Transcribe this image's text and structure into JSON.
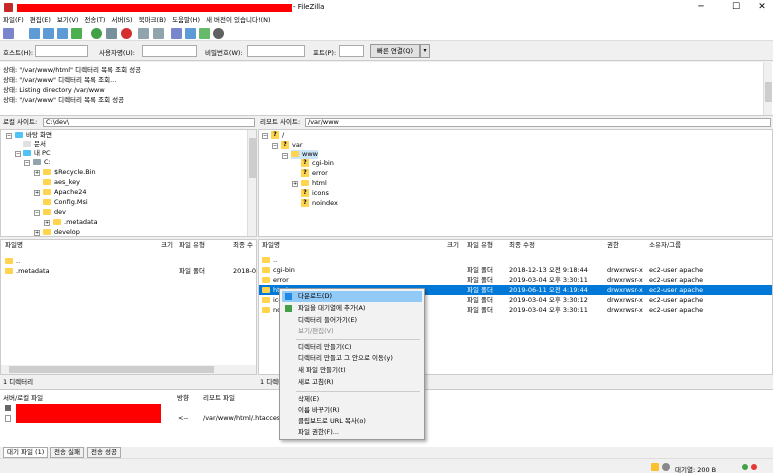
{
  "window": {
    "title": "- FileZilla",
    "minimize": "─",
    "maximize": "☐",
    "close": "✕"
  },
  "menu": [
    "파일(F)",
    "편집(E)",
    "보기(V)",
    "전송(T)",
    "서버(S)",
    "북마크(B)",
    "도움말(H)",
    "새 버전이 있습니다!(N)"
  ],
  "quickconnect": {
    "host_label": "호스트(H):",
    "user_label": "사용자명(U):",
    "pass_label": "비밀번호(W):",
    "port_label": "포트(P):",
    "button": "빠른 연결(Q)",
    "dropdown": "▾"
  },
  "log": [
    "상태:   \"/var/www/html\" 디렉터리 목록 조회 성공",
    "상태:   \"/var/www\" 디렉터리 목록 조회...",
    "상태:   Listing directory /var/www",
    "상태:   \"/var/www\" 디렉터리 목록 조회 성공"
  ],
  "local": {
    "site_label": "로컬 사이트:",
    "site_path": "C:\\dev\\",
    "tree": [
      "바탕 화면",
      "문서",
      "내 PC",
      "C:",
      "$Recycle.Bin",
      "aes_key",
      "Apache24",
      "Config.Msi",
      "dev",
      ".metadata",
      "develop"
    ],
    "headers": {
      "name": "파일명",
      "size": "크기",
      "type": "파일 유형",
      "modified": "최종 수"
    },
    "files": [
      {
        "name": "..",
        "type": "",
        "modified": ""
      },
      {
        "name": ".metadata",
        "type": "파일 폴더",
        "modified": "2018-0"
      }
    ],
    "status": "1 디렉터리"
  },
  "remote": {
    "site_label": "리모트 사이트:",
    "site_path": "/var/www",
    "tree": [
      "/",
      "var",
      "www",
      "cgi-bin",
      "error",
      "html",
      "icons",
      "noindex"
    ],
    "headers": {
      "name": "파일명",
      "size": "크기",
      "type": "파일 유형",
      "modified": "최종 수정",
      "perm": "권한",
      "owner": "소유자/그룹"
    },
    "files": [
      {
        "name": "..",
        "type": "",
        "modified": "",
        "perm": "",
        "owner": ""
      },
      {
        "name": "cgi-bin",
        "type": "파일 폴더",
        "modified": "2018-12-13 오전 9:18:44",
        "perm": "drwxrwsr-x",
        "owner": "ec2-user apache"
      },
      {
        "name": "error",
        "type": "파일 폴더",
        "modified": "2019-03-04 오후 3:30:11",
        "perm": "drwxrwsr-x",
        "owner": "ec2-user apache"
      },
      {
        "name": "html",
        "type": "파일 폴더",
        "modified": "2019-06-11 오전 4:19:44",
        "perm": "drwxrwsr-x",
        "owner": "ec2-user apache"
      },
      {
        "name": "icc",
        "type": "파일 폴더",
        "modified": "2019-03-04 오후 3:30:12",
        "perm": "drwxrwsr-x",
        "owner": "ec2-user apache"
      },
      {
        "name": "no",
        "type": "파일 폴더",
        "modified": "2019-03-04 오후 3:30:11",
        "perm": "drwxrwsr-x",
        "owner": "ec2-user apache"
      }
    ],
    "status": "1 디렉터"
  },
  "context_menu": {
    "items": [
      {
        "label": "다운로드(D)",
        "icon": "download-icon"
      },
      {
        "label": "파일을 대기열에 추가(A)",
        "icon": "queue-add-icon"
      },
      {
        "label": "디렉터리 들어가기(E)"
      },
      {
        "label": "보기/편집(V)"
      },
      {
        "label": "디렉터리 만들기(C)"
      },
      {
        "label": "디렉터리 만들고 그 안으로 이동(y)"
      },
      {
        "label": "새 파일 만들기(t)"
      },
      {
        "label": "새로 고침(R)"
      },
      {
        "label": "삭제(E)"
      },
      {
        "label": "이름 바꾸기(R)"
      },
      {
        "label": "클립보드로 URL 복사(o)"
      },
      {
        "label": "파일 권한(F)..."
      }
    ]
  },
  "queue": {
    "headers": {
      "server": "서버/로컬 파일",
      "direction": "방향",
      "remote": "리모트 파일"
    },
    "row": {
      "direction": "<--",
      "remote": "/var/www/html/.htaccess"
    }
  },
  "tabs": [
    "대기 파일 (1)",
    "전송 실패",
    "전송 성공"
  ],
  "statusbar": {
    "queue": "대기열: 200 B"
  },
  "colors": {
    "redaction": "#ff0000",
    "selection": "#0078d7",
    "folder": "#ffd54f"
  }
}
